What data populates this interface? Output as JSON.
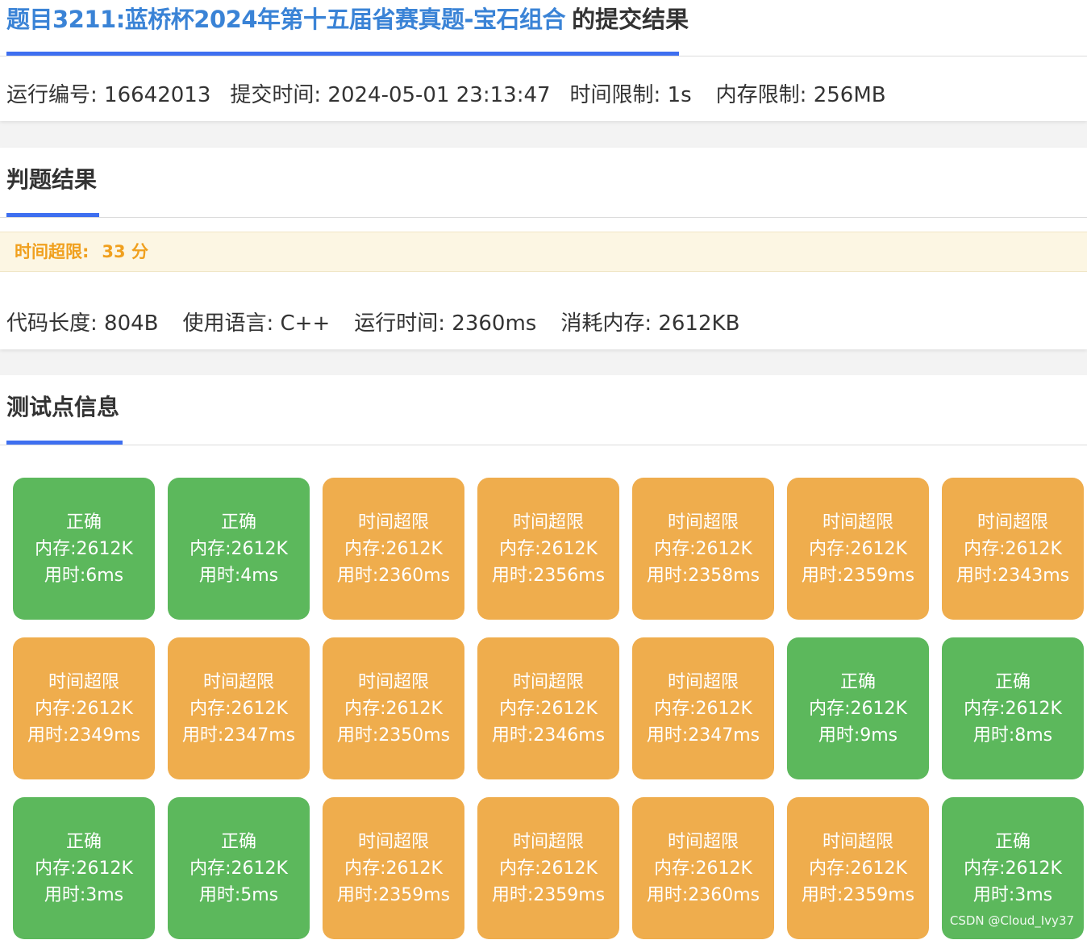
{
  "header": {
    "problem_link": "题目3211:蓝桥杯2024年第十五届省赛真题-宝石组合",
    "title_suffix": "的提交结果"
  },
  "submission": {
    "run_id": "运行编号: 16642013",
    "submit_time": "提交时间: 2024-05-01 23:13:47",
    "time_limit": "时间限制: 1s",
    "memory_limit": "内存限制: 256MB"
  },
  "judge": {
    "section_title": "判题结果",
    "status_label": "时间超限:",
    "score": "33 分",
    "code_length": "代码长度: 804B",
    "language": "使用语言: C++",
    "run_time": "运行时间: 2360ms",
    "memory_used": "消耗内存: 2612KB"
  },
  "testcases": {
    "section_title": "测试点信息",
    "items": [
      {
        "status": "正确",
        "memory": "内存:2612K",
        "time": "用时:6ms",
        "kind": "ok"
      },
      {
        "status": "正确",
        "memory": "内存:2612K",
        "time": "用时:4ms",
        "kind": "ok"
      },
      {
        "status": "时间超限",
        "memory": "内存:2612K",
        "time": "用时:2360ms",
        "kind": "tle"
      },
      {
        "status": "时间超限",
        "memory": "内存:2612K",
        "time": "用时:2356ms",
        "kind": "tle"
      },
      {
        "status": "时间超限",
        "memory": "内存:2612K",
        "time": "用时:2358ms",
        "kind": "tle"
      },
      {
        "status": "时间超限",
        "memory": "内存:2612K",
        "time": "用时:2359ms",
        "kind": "tle"
      },
      {
        "status": "时间超限",
        "memory": "内存:2612K",
        "time": "用时:2343ms",
        "kind": "tle"
      },
      {
        "status": "时间超限",
        "memory": "内存:2612K",
        "time": "用时:2349ms",
        "kind": "tle"
      },
      {
        "status": "时间超限",
        "memory": "内存:2612K",
        "time": "用时:2347ms",
        "kind": "tle"
      },
      {
        "status": "时间超限",
        "memory": "内存:2612K",
        "time": "用时:2350ms",
        "kind": "tle"
      },
      {
        "status": "时间超限",
        "memory": "内存:2612K",
        "time": "用时:2346ms",
        "kind": "tle"
      },
      {
        "status": "时间超限",
        "memory": "内存:2612K",
        "time": "用时:2347ms",
        "kind": "tle"
      },
      {
        "status": "正确",
        "memory": "内存:2612K",
        "time": "用时:9ms",
        "kind": "ok"
      },
      {
        "status": "正确",
        "memory": "内存:2612K",
        "time": "用时:8ms",
        "kind": "ok"
      },
      {
        "status": "正确",
        "memory": "内存:2612K",
        "time": "用时:3ms",
        "kind": "ok"
      },
      {
        "status": "正确",
        "memory": "内存:2612K",
        "time": "用时:5ms",
        "kind": "ok"
      },
      {
        "status": "时间超限",
        "memory": "内存:2612K",
        "time": "用时:2359ms",
        "kind": "tle"
      },
      {
        "status": "时间超限",
        "memory": "内存:2612K",
        "time": "用时:2359ms",
        "kind": "tle"
      },
      {
        "status": "时间超限",
        "memory": "内存:2612K",
        "time": "用时:2360ms",
        "kind": "tle"
      },
      {
        "status": "时间超限",
        "memory": "内存:2612K",
        "time": "用时:2359ms",
        "kind": "tle"
      },
      {
        "status": "正确",
        "memory": "内存:2612K",
        "time": "用时:3ms",
        "kind": "ok"
      }
    ]
  },
  "watermark": "CSDN @Cloud_Ivy37",
  "colors": {
    "accent": "#3e6ff0",
    "link": "#3a83d6",
    "ok": "#5cb85c",
    "tle": "#efad4d",
    "status_text": "#f0a01e",
    "status_bg": "#fcf6e3"
  }
}
